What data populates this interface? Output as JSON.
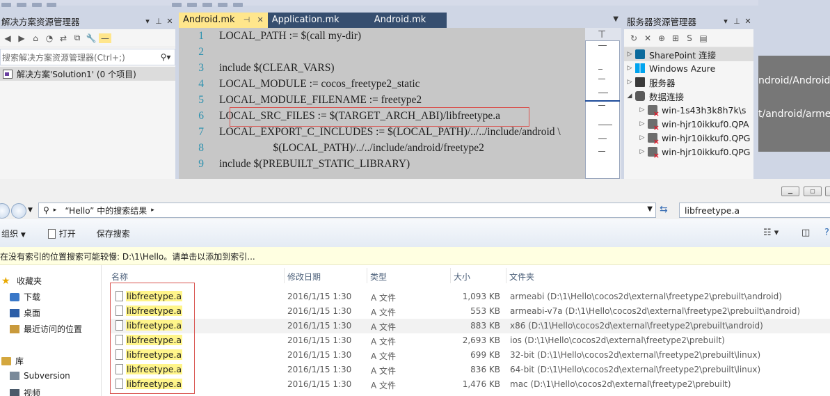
{
  "vs": {
    "solution_explorer": {
      "title": "解决方案资源管理器",
      "search_placeholder": "搜索解决方案资源管理器(Ctrl+;)",
      "solution_item": "解决方案'Solution1' (0 个项目)"
    },
    "editor": {
      "tabs": [
        {
          "label": "Android.mk",
          "active": true
        },
        {
          "label": "Application.mk",
          "active": false
        },
        {
          "label": "Android.mk",
          "active": false
        }
      ],
      "lines": [
        {
          "num": "1",
          "text": "LOCAL_PATH := $(call my-dir)"
        },
        {
          "num": "2",
          "text": ""
        },
        {
          "num": "3",
          "text": "include $(CLEAR_VARS)"
        },
        {
          "num": "4",
          "text": "LOCAL_MODULE := cocos_freetype2_static"
        },
        {
          "num": "5",
          "text": "LOCAL_MODULE_FILENAME := freetype2"
        },
        {
          "num": "6",
          "text": "LOCAL_SRC_FILES := $(TARGET_ARCH_ABI)/libfreetype.a"
        },
        {
          "num": "7",
          "text": "LOCAL_EXPORT_C_INCLUDES := $(LOCAL_PATH)/../../include/android \\"
        },
        {
          "num": "8",
          "text": "                    $(LOCAL_PATH)/../../include/android/freetype2"
        },
        {
          "num": "9",
          "text": "include $(PREBUILT_STATIC_LIBRARY)"
        }
      ]
    },
    "server_explorer": {
      "title": "服务器资源管理器",
      "nodes": [
        {
          "label": "SharePoint 连接",
          "icon": "sharepoint-icon"
        },
        {
          "label": "Windows Azure",
          "icon": "windows-azure-icon"
        },
        {
          "label": "服务器",
          "icon": "server-icon"
        },
        {
          "label": "数据连接",
          "icon": "data-connection-icon"
        },
        {
          "label": "win-1s43h3k8h7k\\s",
          "icon": "db-error-icon"
        },
        {
          "label": "win-hjr10ikkuf0.QPA",
          "icon": "db-error-icon"
        },
        {
          "label": "win-hjr10ikkuf0.QPG",
          "icon": "db-error-icon"
        },
        {
          "label": "win-hjr10ikkuf0.QPG",
          "icon": "db-error-icon"
        }
      ]
    },
    "background_text": {
      "line1": "ndroid/Android.m",
      "line2": "t/android/armea"
    }
  },
  "explorer": {
    "breadcrumb": "“Hello” 中的搜索结果",
    "search_value": "libfreetype.a",
    "commands": {
      "organize": "组织",
      "open": "打开",
      "save_search": "保存搜索"
    },
    "info_bar": "在没有索引的位置搜索可能较慢: D:\\1\\Hello。请单击以添加到索引...",
    "nav": {
      "favorites": "收藏夹",
      "downloads": "下载",
      "desktop": "桌面",
      "recent": "最近访问的位置",
      "libraries": "库",
      "subversion": "Subversion",
      "videos": "视频"
    },
    "columns": [
      "名称",
      "修改日期",
      "类型",
      "大小",
      "文件夹"
    ],
    "rows": [
      {
        "name": "libfreetype.a",
        "date": "2016/1/15 1:30",
        "type": "A 文件",
        "size": "1,093 KB",
        "folder": "armeabi (D:\\1\\Hello\\cocos2d\\external\\freetype2\\prebuilt\\android)"
      },
      {
        "name": "libfreetype.a",
        "date": "2016/1/15 1:30",
        "type": "A 文件",
        "size": "553 KB",
        "folder": "armeabi-v7a (D:\\1\\Hello\\cocos2d\\external\\freetype2\\prebuilt\\android)"
      },
      {
        "name": "libfreetype.a",
        "date": "2016/1/15 1:30",
        "type": "A 文件",
        "size": "883 KB",
        "folder": "x86 (D:\\1\\Hello\\cocos2d\\external\\freetype2\\prebuilt\\android)"
      },
      {
        "name": "libfreetype.a",
        "date": "2016/1/15 1:30",
        "type": "A 文件",
        "size": "2,693 KB",
        "folder": "ios (D:\\1\\Hello\\cocos2d\\external\\freetype2\\prebuilt)"
      },
      {
        "name": "libfreetype.a",
        "date": "2016/1/15 1:30",
        "type": "A 文件",
        "size": "699 KB",
        "folder": "32-bit (D:\\1\\Hello\\cocos2d\\external\\freetype2\\prebuilt\\linux)"
      },
      {
        "name": "libfreetype.a",
        "date": "2016/1/15 1:30",
        "type": "A 文件",
        "size": "836 KB",
        "folder": "64-bit (D:\\1\\Hello\\cocos2d\\external\\freetype2\\prebuilt\\linux)"
      },
      {
        "name": "libfreetype.a",
        "date": "2016/1/15 1:30",
        "type": "A 文件",
        "size": "1,476 KB",
        "folder": "mac (D:\\1\\Hello\\cocos2d\\external\\freetype2\\prebuilt)"
      }
    ]
  }
}
